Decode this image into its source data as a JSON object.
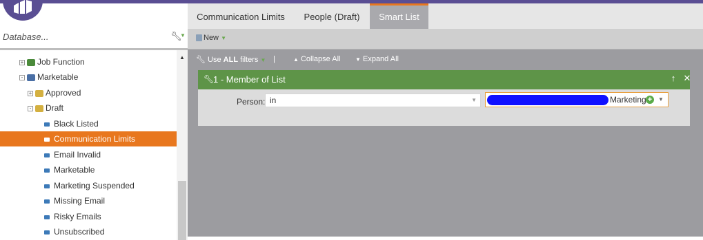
{
  "search": {
    "placeholder": "Database..."
  },
  "tree": [
    {
      "label": "Job Function",
      "kind": "folder",
      "expander": "+"
    },
    {
      "label": "Marketable",
      "kind": "folder",
      "expander": "-"
    },
    {
      "label": "Approved",
      "kind": "folder",
      "expander": "+"
    },
    {
      "label": "Draft",
      "kind": "folder",
      "expander": "-"
    },
    {
      "label": "Black Listed",
      "kind": "list"
    },
    {
      "label": "Communication Limits",
      "kind": "list",
      "selected": true
    },
    {
      "label": "Email Invalid",
      "kind": "list"
    },
    {
      "label": "Marketable",
      "kind": "list"
    },
    {
      "label": "Marketing Suspended",
      "kind": "list"
    },
    {
      "label": "Missing Email",
      "kind": "list"
    },
    {
      "label": "Risky Emails",
      "kind": "list"
    },
    {
      "label": "Unsubscribed",
      "kind": "list"
    }
  ],
  "tabs": [
    {
      "label": "Communication Limits"
    },
    {
      "label": "People (Draft)"
    },
    {
      "label": "Smart List",
      "active": true
    }
  ],
  "toolbar": {
    "new_label": "New",
    "use_prefix": "Use ",
    "use_bold": "ALL",
    "use_suffix": " filters",
    "separator": "|",
    "collapse_all": "Collapse All",
    "expand_all": "Expand All"
  },
  "filter": {
    "title": "1 - Member of List",
    "field_label": "Person:",
    "operator": "in",
    "value": "Marketing"
  },
  "colors": {
    "brand": "#5a4e93",
    "selected": "#e8771e",
    "filter_header": "#5e9448"
  }
}
